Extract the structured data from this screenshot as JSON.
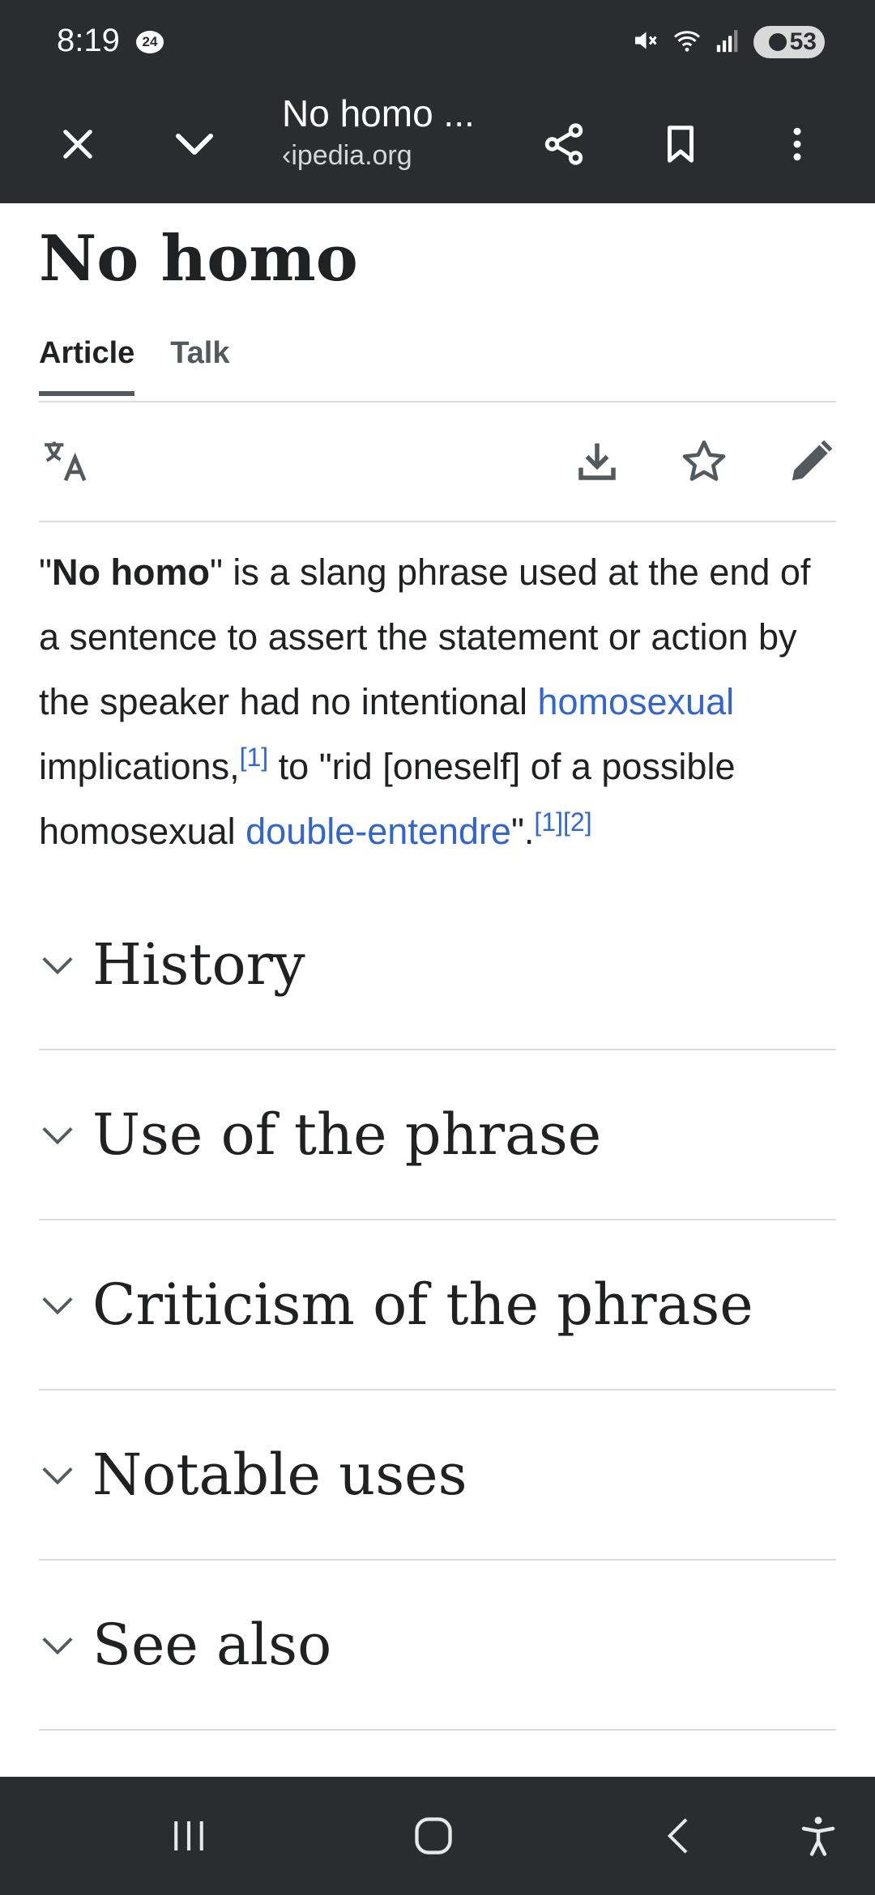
{
  "status": {
    "time": "8:19",
    "notif_badge": "24",
    "battery": "53"
  },
  "toolbar": {
    "title": "No homo ...",
    "url": "‹ipedia.org"
  },
  "article": {
    "title": "No homo",
    "tabs": [
      {
        "label": "Article"
      },
      {
        "label": "Talk"
      }
    ],
    "lead": {
      "q1": "\"",
      "bold": "No homo",
      "t1": "\" is a slang phrase used at the end of a sentence to assert the statement or action by the speaker had no intentional ",
      "link1": "homosexual",
      "t2": " implications,",
      "ref1": "[1]",
      "t3": " to \"rid [oneself] of a possible homosexual ",
      "link2": "double-entendre",
      "t4": "\".",
      "ref2": "[1]",
      "ref3": "[2]"
    },
    "sections": [
      {
        "label": "History"
      },
      {
        "label": "Use of the phrase"
      },
      {
        "label": "Criticism of the phrase"
      },
      {
        "label": "Notable uses"
      },
      {
        "label": "See also"
      }
    ]
  },
  "colors": {
    "bar": "#2b2c2f",
    "link": "#3366cc",
    "text": "#202122"
  }
}
